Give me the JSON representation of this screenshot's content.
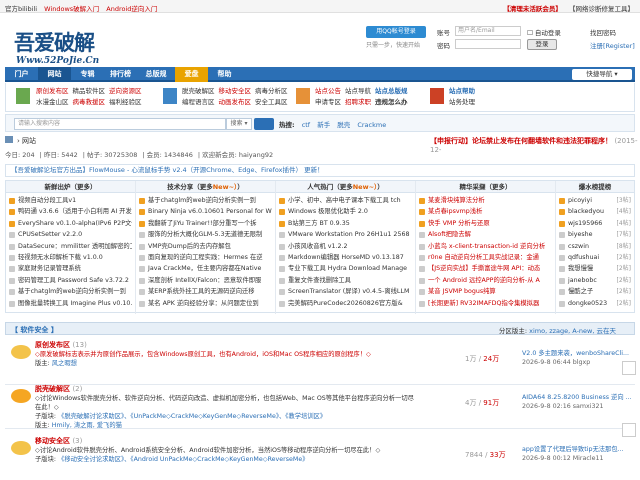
{
  "topbar": {
    "items": [
      "官方bilibili",
      "Windows破解入门",
      "Android逆向入门"
    ],
    "right": [
      "【清理未活跃会员】",
      "【网络诊断修复工具】"
    ]
  },
  "logo": {
    "big": "吾爱破解",
    "small": "Www.52PoJie.Cn"
  },
  "qq": {
    "label": "用QQ帐号登录",
    "quick": "只需一步，快速开始"
  },
  "login": {
    "acct_label": "账号",
    "acct_ph": "用户名/Email",
    "pw_label": "密码",
    "auto": "自动登录",
    "find": "找回密码",
    "login_btn": "登录",
    "reg": "注册[Register]"
  },
  "nav": {
    "items": [
      "门户",
      "网站",
      "专辑",
      "排行榜",
      "总版规",
      "爱盘",
      "帮助"
    ],
    "quick": "快捷导航"
  },
  "subnav": {
    "g1": [
      "原创发布区",
      "精品软件区",
      "逆向资源区",
      "水漫金山区",
      "病毒救援区",
      "福利经验区"
    ],
    "g2": [
      "脱壳破解区",
      "移动安全区",
      "病毒分析区",
      "编程语言区",
      "动画发布区",
      "安全工具区"
    ],
    "g3": [
      "站点公告",
      "站点导航",
      "站点总版规",
      "申请专区",
      "招聘求职",
      "违规怎么办"
    ],
    "g4": [
      "站点帮助",
      "站务处理"
    ]
  },
  "search": {
    "placeholder": "请输入搜索内容",
    "select": "搜索",
    "hot_label": "热搜:",
    "hot": [
      "ctf",
      "新手",
      "脱壳",
      "Crackme"
    ]
  },
  "crumb": [
    "网站"
  ],
  "redlink": {
    "text": "【申报行动】论坛禁止发布在何翻墙软件和违法犯罪程序！",
    "date": "(2015-12-"
  },
  "stats": [
    "今日: 204",
    "昨日: 5442",
    "帖子: 30725308",
    "会员: 1434846",
    "欢迎新会员: haiyang92"
  ],
  "notice": "【吾爱破解论坛官方出品】FlowMouse - 心流鼠标手势 v2.4（开源Chrome、Edge、Firefox插件） 更新！",
  "columns": [
    {
      "title": "新鲜出炉（更多",
      "more": "）",
      "items": [
        "视频自动分段工具v1",
        "鸭码通 v3.6.6（适用于小白利用 AI 开发",
        "EveryShare v0.1.0-alpha(IPv6 P2P文件",
        "CPUSetSetter v2.2.0",
        "DataSecure：mmilitter 透明加解密的工",
        "轻视频无水印解析下载 v1.0.0",
        "家庭财务记录管理系统",
        "密码管理工具 Password Safe v3.72.2",
        "基于chatglm的web逆向分析实例一到",
        "图像批量转换工具 Imagine Plus v0.10.4"
      ]
    },
    {
      "title": "技术分享（更多",
      "more": "New~）",
      "items": [
        "基于chatglm的web逆向分析实例一到",
        "Binary Ninja v6.0.10601 Personal for Wi",
        "我翻新了JiYu Trainer!!部分重写一个拆",
        "服饰的分析大概化GLM-5.3无道德无限制",
        "VMP壳Dump后的去内存解包",
        "面向复现的逆向工程实践：Hermes 在逆",
        "Java CrackMe，任主要内容都在Native",
        "深度剖析 IntellX/Falcon：恶意软件即服",
        "某ERP系统外挂工具的无源码逆向迁移",
        "某名 APK 逆向经验分享：从问题定位到"
      ]
    },
    {
      "title": "人气热门（更多",
      "more": "New~）",
      "items": [
        "小学、初中、高中电子课本下载工具 tch",
        "Windows 极限优化助手 2.0",
        "B站第三方 BT 0.9.35",
        "VMware Workstation Pro 26H1u1 2568",
        "小孩风收音机 v1.2.2",
        "Markdown编辑器 HorseMD v0.13.187",
        "专业下载工具 Hydra Download Manage",
        "重复文件查找删除工具",
        "ScreenTranslator (屏译) v0.4.5-离线LLM",
        "完美解码PureCodec20260826官方版&"
      ]
    },
    {
      "title": "精华采撷（更多",
      "more": "）",
      "items": [
        "某麦滑块纯算法分析",
        "某点春ipsvmp浅析",
        "快手 VMP 分析与还原",
        "Alsoft把隐去解",
        "小蓝鸟 x-client-transaction-id 逆向分析",
        "r0ne 自动逆向分析工具实战记录：金通",
        "【JS逆向实战】手撕富途牛网 API：动态",
        "一个 Android 远控APP的逆向分析-从 A",
        "某音 JSVMP bogus纯算",
        "[长期更新] RV32IMAFDQ指令集模拟器"
      ]
    },
    {
      "title": "爆水榜提榜",
      "items": [
        "picoyiyi",
        "blackedyou",
        "wjs195966",
        "biyeshe",
        "cszwin",
        "qdfushuai",
        "我想慢慢",
        "janebobc",
        "慢酷之子",
        "dongke0523"
      ],
      "idx": [
        "[3帖]",
        "[4帖]",
        "[4帖]",
        "[7帖]",
        "[8帖]",
        "[2帖]",
        "[2帖]",
        "[2帖]",
        "[2帖]",
        "[2帖]"
      ]
    }
  ],
  "section": {
    "title": "【 软件安全 】",
    "mods_label": "分区版主:",
    "mods": "ximo, zzage, A-new, 云在天"
  },
  "forums": [
    {
      "name": "原创发布区",
      "today": "(13)",
      "desc": "◇原发破解标志表示并为原创作品展示，包含Windows原创工具，也有Android，iOS和Mac OS程序相应的原创程序！◇",
      "mod_label": "版主:",
      "mod": "风之暇想",
      "count": "1万",
      "count_sep": "/",
      "count2": "24万",
      "last1": "V2.0 多主题来袭，wenboShareCli...",
      "last2": "2026-9-8 06:44 blgxp"
    },
    {
      "name": "脱壳破解区",
      "today": "(2)",
      "desc": "◇讨论Windows软件脱壳分析、软件逆向分析、代码逆向改造、虚拟机加密分析，也包括Web、Mac OS等其他平台程序逆向分析一切尽在此！◇",
      "sub_label": "子版块:",
      "sub": "《脱壳破解讨论求助区》、《UnPackMe◇CrackMe◇KeyGenMe◇ReverseMe》、《教学培训区》",
      "mod_label": "版主:",
      "mod": "Hmily, 涛之雨, 爱飞的猫",
      "count": "4万",
      "count_sep": "/",
      "count2": "91万",
      "last1": "AIDA64 8.25.8200 Business 逆向 ...",
      "last2": "2026-9-8 02:16 samxi321"
    },
    {
      "name": "移动安全区",
      "today": "(3)",
      "desc": "◇讨论Android软件脱壳分析、Android系统安全分析、Android软件加密分析，当然iOS等移动程序逆向分析一切尽在此！◇",
      "sub_label": "子版块:",
      "sub": "《移动安全讨论求助区》、《Android UnPackMe◇CrackMe◇KeyGenMe◇ReverseMe》",
      "count": "7844",
      "count_sep": "/",
      "count2": "33万",
      "last1": "app设置了代理后导致tip无法那包...",
      "last2": "2026-9-8 00:12 Miracle11"
    }
  ]
}
